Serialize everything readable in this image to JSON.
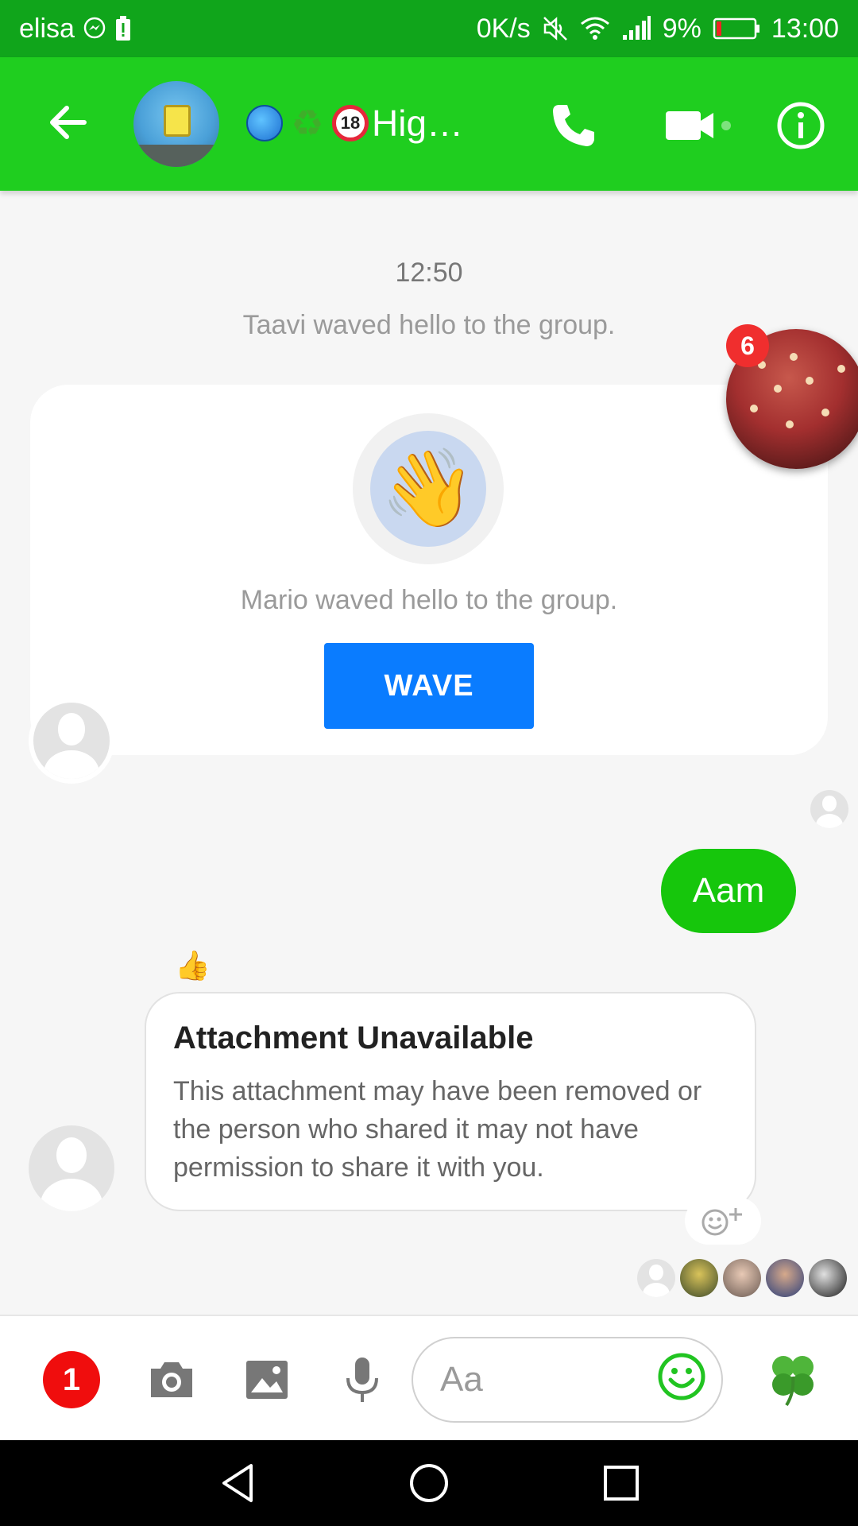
{
  "status_bar": {
    "carrier": "elisa",
    "net_speed": "0K/s",
    "battery": "9%",
    "time": "13:00"
  },
  "header": {
    "title": "Hig…",
    "back_icon": "arrow-left-icon",
    "call_icon": "phone-icon",
    "video_icon": "video-camera-icon",
    "info_icon": "info-icon",
    "brand_color": "#1fce1f"
  },
  "chat": {
    "timestamp": "12:50",
    "system_message": "Taavi waved hello to the group.",
    "wave_card": {
      "text": "Mario waved hello to the group.",
      "button_label": "WAVE",
      "emoji": "👋"
    },
    "chat_head_badge": "6",
    "outgoing_message": "Aam",
    "reaction": "👍",
    "attachment": {
      "title": "Attachment Unavailable",
      "body": "This attachment may have been removed or the person who shared it may not have permission to share it with you."
    }
  },
  "composer": {
    "badge_count": "1",
    "placeholder": "Aa",
    "camera_icon": "camera-icon",
    "gallery_icon": "image-icon",
    "mic_icon": "microphone-icon",
    "emoji_icon": "smiley-icon",
    "clover": "🍀"
  },
  "navigation": {
    "back_icon": "triangle-back-icon",
    "home_icon": "circle-home-icon",
    "recent_icon": "square-recents-icon"
  }
}
